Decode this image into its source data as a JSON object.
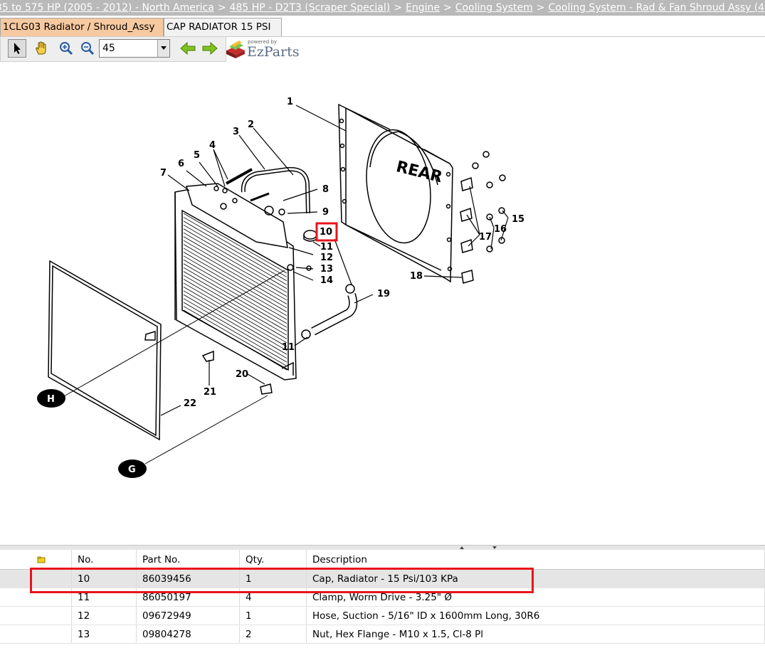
{
  "breadcrumb": {
    "items": [
      "35 to 575 HP (2005 - 2012) - North America",
      "485 HP - D2T3 (Scraper Special)",
      "Engine",
      "Cooling System",
      "Cooling System - Rad & Fan Shroud Assy (4"
    ],
    "separator": ">"
  },
  "tabs": [
    {
      "label": "1CLG03 Radiator / Shroud_Assy",
      "active": true
    },
    {
      "label": "CAP RADIATOR 15 PSI",
      "active": false
    }
  ],
  "toolbar": {
    "zoom_value": "45",
    "icons": [
      "pointer-icon",
      "hand-pan-icon",
      "zoom-in-icon",
      "zoom-out-icon",
      "back-arrow-icon",
      "forward-arrow-icon"
    ]
  },
  "logo": {
    "powered": "powered by",
    "brand": "EzParts"
  },
  "drawing": {
    "callouts": [
      "1",
      "2",
      "3",
      "4",
      "5",
      "6",
      "7",
      "8",
      "9",
      "10",
      "11",
      "12",
      "13",
      "14",
      "15",
      "16",
      "17",
      "18",
      "19",
      "11",
      "20",
      "21",
      "22"
    ],
    "rear_label": "REAR",
    "view_h": "H",
    "view_g": "G",
    "selected_callout": "10",
    "highlight_color": "#e8141c"
  },
  "table": {
    "headers": {
      "no": "No.",
      "part": "Part No.",
      "qty": "Qty.",
      "desc": "Description"
    },
    "rows": [
      {
        "no": "10",
        "part": "86039456",
        "qty": "1",
        "desc": "Cap, Radiator - 15 Psi/103 KPa",
        "selected": true
      },
      {
        "no": "11",
        "part": "86050197",
        "qty": "4",
        "desc": "Clamp, Worm Drive - 3.25\" Ø",
        "selected": false
      },
      {
        "no": "12",
        "part": "09672949",
        "qty": "1",
        "desc": "Hose, Suction - 5/16\" ID x 1600mm Long, 30R6",
        "selected": false
      },
      {
        "no": "13",
        "part": "09804278",
        "qty": "2",
        "desc": "Nut, Hex Flange - M10 x 1.5, Cl-8 Pl",
        "selected": false
      }
    ]
  }
}
